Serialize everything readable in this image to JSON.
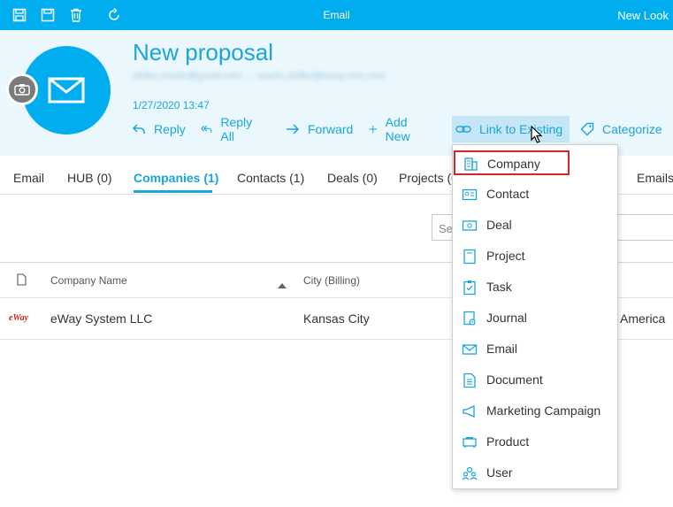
{
  "window": {
    "title": "Email",
    "new_look_label": "New Look"
  },
  "toolbar_icons": [
    "save-close-icon",
    "save-icon",
    "delete-icon",
    "refresh-icon"
  ],
  "header": {
    "title": "New proposal",
    "subtitle_blurred": "zlefko.martin@gmail.com → martin.zlefko@eway-crm.com",
    "date": "1/27/2020 13:47"
  },
  "actions": [
    {
      "label": "Reply"
    },
    {
      "label": "Reply All"
    },
    {
      "label": "Forward"
    },
    {
      "label": "Add New"
    },
    {
      "label": "Link to Existing"
    },
    {
      "label": "Categorize"
    }
  ],
  "tabs": [
    {
      "label": "Email"
    },
    {
      "label": "HUB (0)"
    },
    {
      "label": "Companies (1)"
    },
    {
      "label": "Contacts (1)"
    },
    {
      "label": "Deals (0)"
    },
    {
      "label": "Projects (0)"
    },
    {
      "label": "Emails"
    }
  ],
  "search": {
    "placeholder": "Se"
  },
  "grid": {
    "columns": [
      "Company Name",
      "City (Billing)"
    ],
    "rows": [
      {
        "logo": "eWay",
        "company": "eWay System LLC",
        "city": "Kansas City",
        "extra": "America"
      }
    ]
  },
  "dropdown": {
    "items": [
      {
        "label": "Company",
        "icon": "company-icon",
        "selected": true
      },
      {
        "label": "Contact",
        "icon": "contact-icon"
      },
      {
        "label": "Deal",
        "icon": "deal-icon"
      },
      {
        "label": "Project",
        "icon": "project-icon"
      },
      {
        "label": "Task",
        "icon": "task-icon"
      },
      {
        "label": "Journal",
        "icon": "journal-icon"
      },
      {
        "label": "Email",
        "icon": "email-icon"
      },
      {
        "label": "Document",
        "icon": "document-icon"
      },
      {
        "label": "Marketing Campaign",
        "icon": "marketing-campaign-icon"
      },
      {
        "label": "Product",
        "icon": "product-icon"
      },
      {
        "label": "User",
        "icon": "user-icon"
      }
    ]
  },
  "colors": {
    "accent": "#1aa5dc",
    "titlebar": "#00aeef",
    "highlight_border": "#d9252a"
  }
}
